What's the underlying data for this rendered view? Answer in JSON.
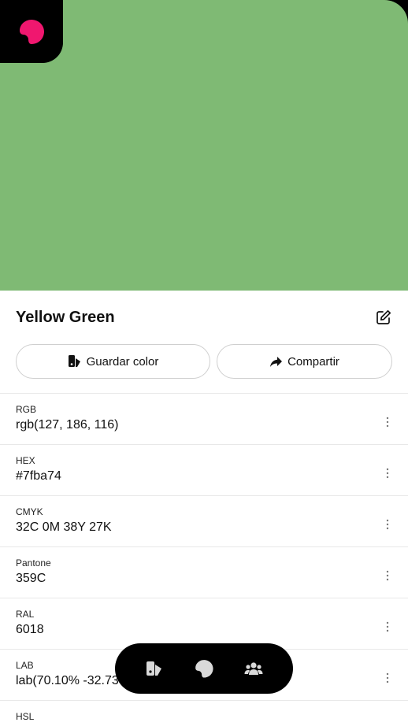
{
  "color": {
    "name": "Yellow Green",
    "swatch_hex": "#7fba74",
    "brand_accent": "#f0176f"
  },
  "actions": {
    "save_label": "Guardar color",
    "share_label": "Compartir"
  },
  "formats": [
    {
      "label": "RGB",
      "value": "rgb(127, 186, 116)"
    },
    {
      "label": "HEX",
      "value": "#7fba74"
    },
    {
      "label": "CMYK",
      "value": "32C 0M 38Y 27K"
    },
    {
      "label": "Pantone",
      "value": "359C"
    },
    {
      "label": "RAL",
      "value": "6018"
    },
    {
      "label": "LAB",
      "value": "lab(70.10% -32.73"
    },
    {
      "label": "HSL",
      "value": ""
    }
  ],
  "nav": {
    "items": [
      {
        "icon": "swatchbook-icon"
      },
      {
        "icon": "palette-icon"
      },
      {
        "icon": "community-icon"
      }
    ]
  }
}
